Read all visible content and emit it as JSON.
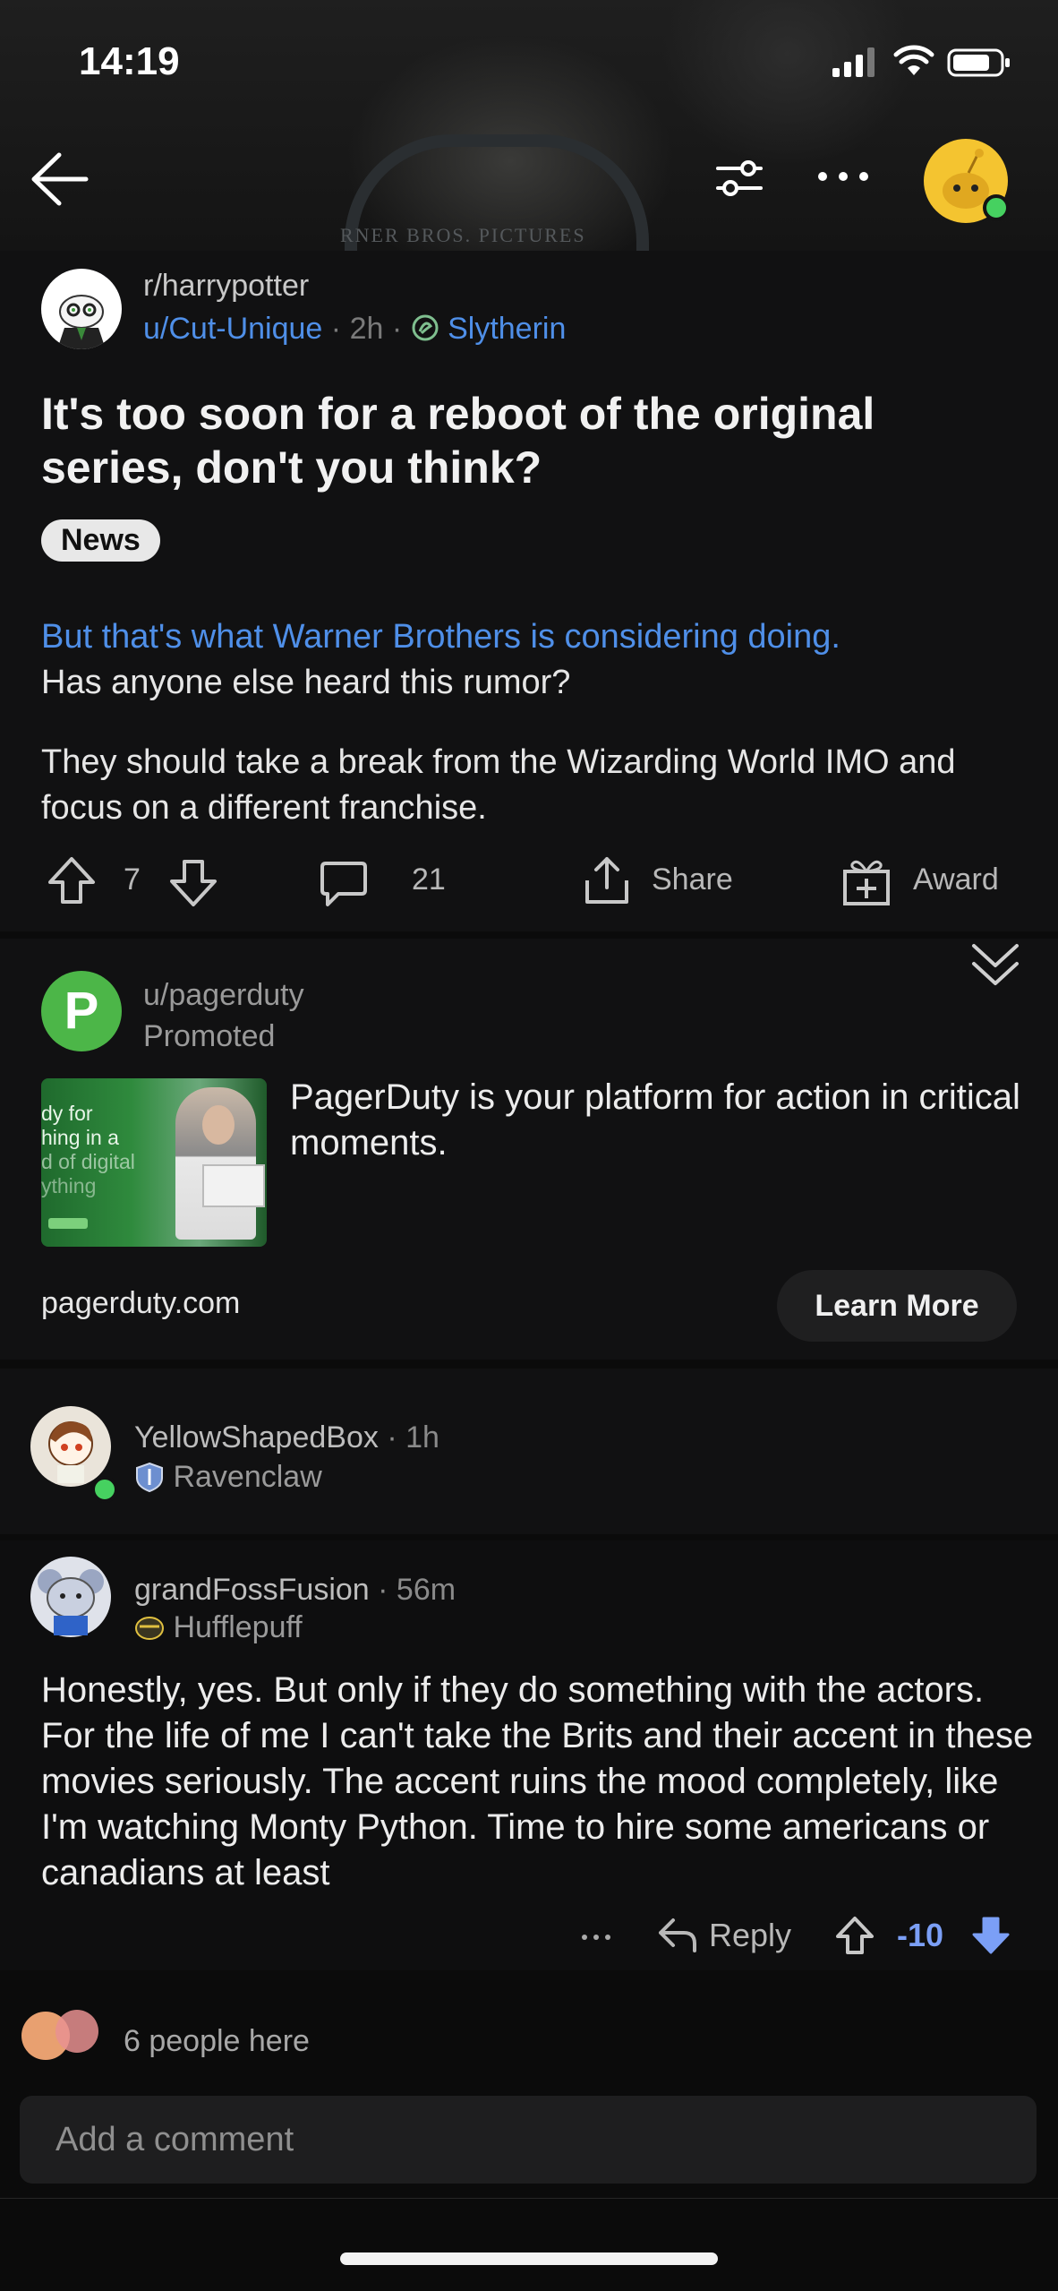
{
  "status_bar": {
    "time": "14:19"
  },
  "banner": {
    "text": "RNER BROS. PICTURES"
  },
  "post": {
    "subreddit": "r/harrypotter",
    "author": "u/Cut-Unique",
    "age": "2h",
    "user_flair": "Slytherin",
    "title": "It's too soon for a reboot of the original series, don't you think?",
    "flair": "News",
    "link_text": "But that's what Warner Brothers is considering doing.",
    "body_line2": "Has anyone else heard this rumor?",
    "body_para2": "They should take a break from the Wizarding World IMO and focus on a different franchise.",
    "upvotes": "7",
    "comments": "21",
    "share_label": "Share",
    "award_label": "Award"
  },
  "ad": {
    "avatar_letter": "P",
    "user": "u/pagerduty",
    "promoted_label": "Promoted",
    "image_text_lines": [
      "dy for",
      "hing in a",
      "d of digital",
      "ything"
    ],
    "text": "PagerDuty is your platform for action in critical moments.",
    "domain": "pagerduty.com",
    "cta": "Learn More"
  },
  "comments": [
    {
      "user": "YellowShapedBox",
      "age": "1h",
      "flair": "Ravenclaw"
    },
    {
      "user": "grandFossFusion",
      "age": "56m",
      "flair": "Hufflepuff",
      "body": "Honestly, yes. But only if they do something with the actors. For the life of me I can't take the Brits and their accent in these movies seriously. The accent ruins the mood completely, like I'm watching Monty Python. Time to hire some americans or canadians at least",
      "reply_label": "Reply",
      "score": "-10"
    }
  ],
  "bottom": {
    "people_here": "6 people here",
    "comment_placeholder": "Add a comment"
  },
  "colors": {
    "accent_blue": "#4f8fe8",
    "online_green": "#46d160",
    "downvote_blue": "#7b9ff6"
  }
}
